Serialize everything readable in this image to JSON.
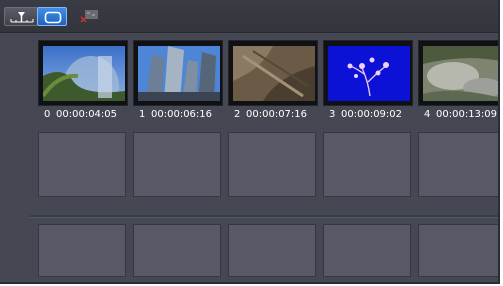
{
  "toolbar": {
    "buttons": [
      {
        "icon": "timeline-view-icon",
        "active": false
      },
      {
        "icon": "storyboard-view-icon",
        "active": true
      },
      {
        "icon": "effect-tool-icon",
        "active": false
      }
    ]
  },
  "clips": [
    {
      "index": "0",
      "timecode": "00:00:04:05"
    },
    {
      "index": "1",
      "timecode": "00:00:06:16"
    },
    {
      "index": "2",
      "timecode": "00:00:07:16"
    },
    {
      "index": "3",
      "timecode": "00:00:09:02"
    },
    {
      "index": "4",
      "timecode": "00:00:13:09"
    }
  ],
  "colors": {
    "panel_bg": "#454752",
    "slot_bg": "#575a66",
    "active_button": "#2f7be0",
    "label_text": "#ffffff"
  }
}
